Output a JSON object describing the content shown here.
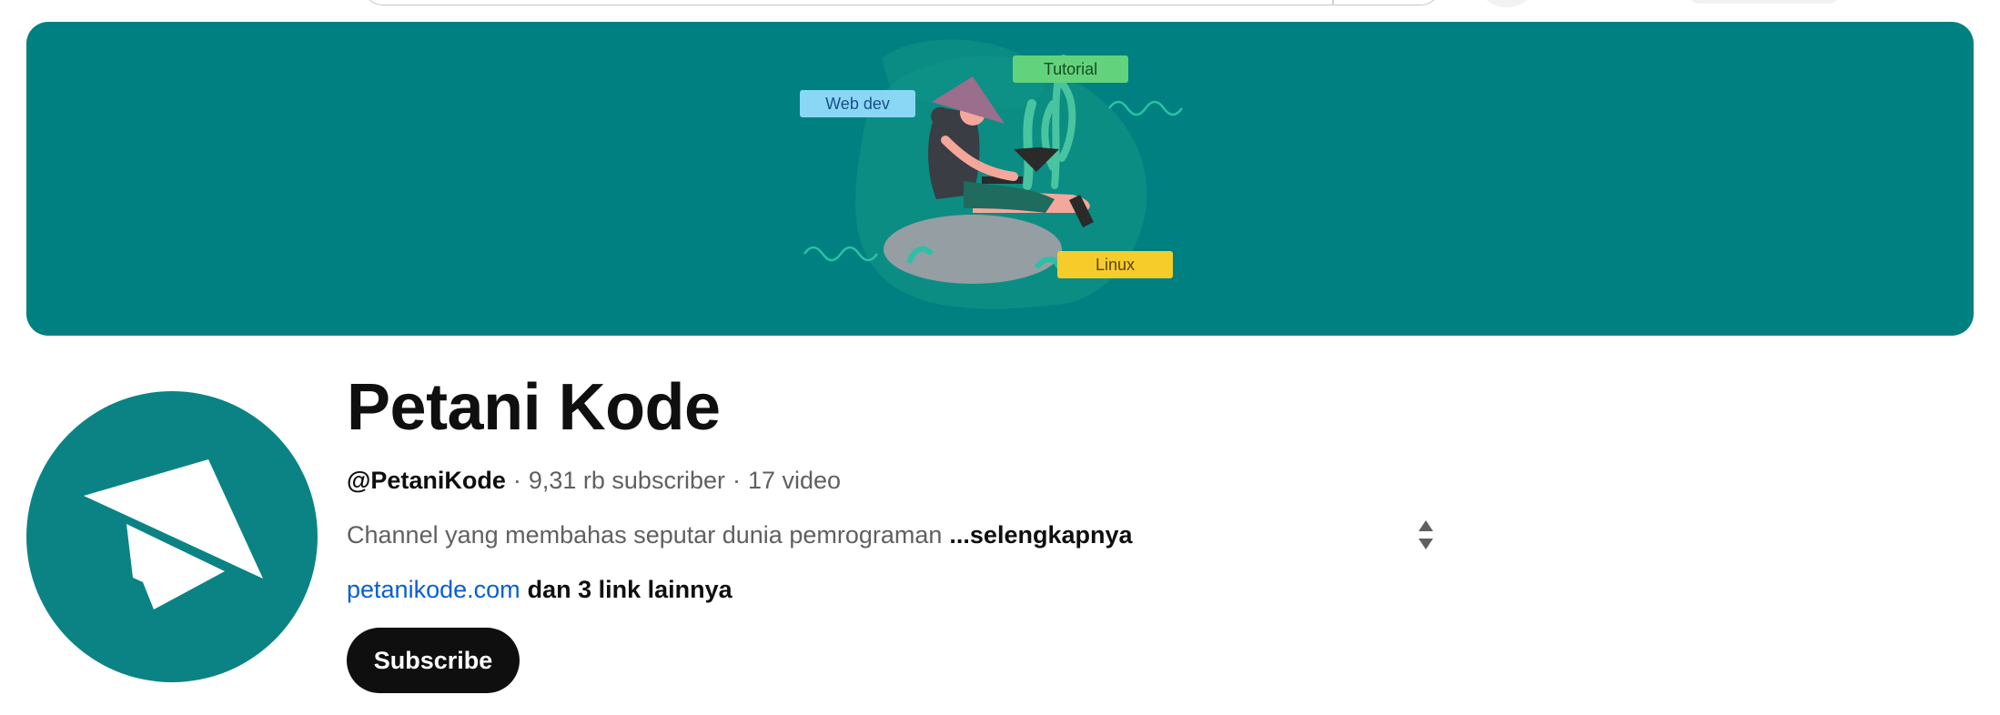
{
  "banner": {
    "tags": [
      {
        "label": "Web dev",
        "color": "#8ad7f5",
        "text_color": "#1b4f8a"
      },
      {
        "label": "Tutorial",
        "color": "#63d27c",
        "text_color": "#154d22"
      },
      {
        "label": "Linux",
        "color": "#f5cc2a",
        "text_color": "#5a4700"
      }
    ],
    "background_color": "#008080"
  },
  "channel": {
    "name": "Petani Kode",
    "handle": "@PetaniKode",
    "subscribers": "9,31 rb subscriber",
    "videos": "17 video",
    "separator": "·",
    "description": "Channel yang membahas seputar dunia pemrograman",
    "more_label": "...selengkapnya",
    "link": "petanikode.com",
    "more_links": "dan 3 link lainnya",
    "subscribe_label": "Subscribe",
    "avatar_icon": "paper-plane-icon",
    "avatar_color": "#0b8385"
  }
}
